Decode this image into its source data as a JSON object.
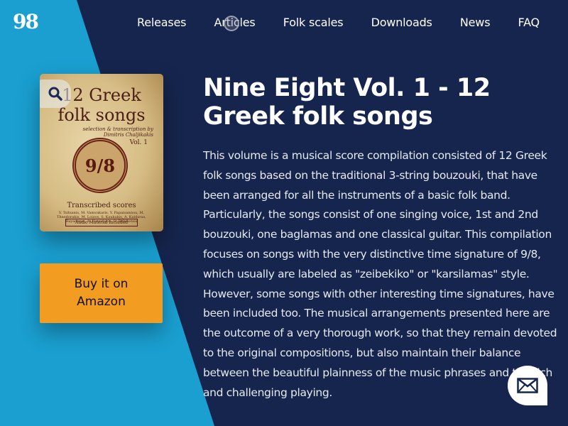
{
  "colors": {
    "left_panel": "#1a9fd0",
    "right_panel": "#16254d",
    "buy_button": "#f39c22",
    "text": "#ffffff"
  },
  "header": {
    "logo": "98",
    "nav": [
      {
        "label": "Releases"
      },
      {
        "label": "Articles"
      },
      {
        "label": "Folk scales"
      },
      {
        "label": "Downloads"
      },
      {
        "label": "News"
      },
      {
        "label": "FAQ"
      }
    ]
  },
  "product": {
    "cover": {
      "title_line1": "12 Greek",
      "title_line2": "folk songs",
      "subtitle": "selection & transcription by Dimitris Chaljikakis",
      "volume": "Vol. 1",
      "seal_text": "9/8",
      "section": "Transcribed scores",
      "names": "V. Tsitsanis, M. Vamvakaris, Y. Papaioannou, M. Theodorakis, M. Loizos, S. Kaukakis, A. Kaldaras, Bayaderas, A. Hatzidakis, G. Bithikotsis",
      "audio_badge": "Audio Material Included"
    },
    "zoom_icon": "magnifier-icon",
    "buy_label": "Buy it on Amazon",
    "title": "Nine Eight Vol. 1 - 12 Greek folk songs",
    "description": "This volume is a musical score compilation consisted of 12 Greek folk songs based on the traditional 3-string bouzouki, that have been arranged for all the instruments of a basic folk band. Particularly, the songs consist of one singing voice, 1st and 2nd bouzouki, one baglamas and one classical guitar. This compilation focuses on songs with the very distinctive time signature of 9/8, which usually are labeled as \"zeibekiko\" or \"karsilamas\" style. However, some songs with other interesting time signatures, have been included too. The musical arrangements presented here are the outcome of a very thorough work, so that they remain devoted to the original compositions, but also maintain their balance between the beautiful plainness of the music phrases and the rich and challenging playing."
  },
  "contact": {
    "icon": "envelope-icon"
  }
}
